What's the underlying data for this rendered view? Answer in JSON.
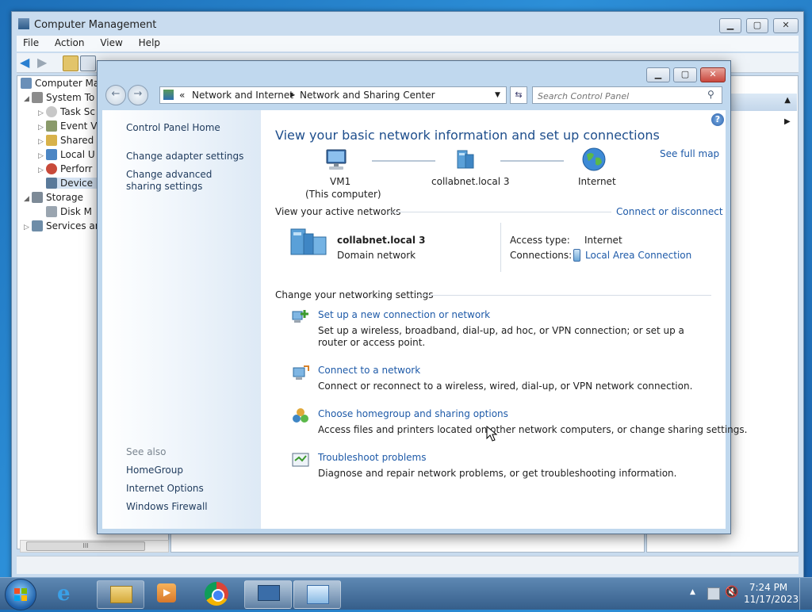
{
  "computer_management": {
    "title": "Computer Management",
    "menu": [
      "File",
      "Action",
      "View",
      "Help"
    ],
    "tree": [
      {
        "label": "Computer Ma",
        "icon": "computer-icon"
      },
      {
        "label": "System To",
        "icon": "tools-icon"
      },
      {
        "label": "Task Sc",
        "icon": "clock-icon"
      },
      {
        "label": "Event V",
        "icon": "event-viewer-icon"
      },
      {
        "label": "Shared",
        "icon": "shared-folder-icon"
      },
      {
        "label": "Local U",
        "icon": "users-icon"
      },
      {
        "label": "Perforr",
        "icon": "performance-icon"
      },
      {
        "label": "Device",
        "icon": "device-manager-icon"
      },
      {
        "label": "Storage",
        "icon": "storage-icon"
      },
      {
        "label": "Disk M",
        "icon": "disk-icon"
      },
      {
        "label": "Services ar",
        "icon": "services-icon"
      }
    ],
    "hscroll_glyph": "III"
  },
  "nsc": {
    "address": {
      "prefix": "«",
      "crumb1": "Network and Internet",
      "crumb2": "Network and Sharing Center"
    },
    "search_placeholder": "Search Control Panel",
    "left": {
      "home": "Control Panel Home",
      "adapter": "Change adapter settings",
      "advanced": "Change advanced sharing settings",
      "see_also": "See also",
      "homegroup": "HomeGroup",
      "internet_options": "Internet Options",
      "firewall": "Windows Firewall"
    },
    "heading": "View your basic network information and set up connections",
    "see_full_map": "See full map",
    "map": {
      "vm_name": "VM1",
      "vm_sub": "(This computer)",
      "domain": "collabnet.local  3",
      "internet": "Internet"
    },
    "active": {
      "label": "View your active networks",
      "connect_link": "Connect or disconnect",
      "network_name": "collabnet.local  3",
      "network_type": "Domain network",
      "access_label": "Access type:",
      "access_value": "Internet",
      "connections_label": "Connections:",
      "connections_value": "Local Area Connection"
    },
    "change": {
      "label": "Change your networking settings",
      "tasks": [
        {
          "title": "Set up a new connection or network",
          "desc": "Set up a wireless, broadband, dial-up, ad hoc, or VPN connection; or set up a router or access point."
        },
        {
          "title": "Connect to a network",
          "desc": "Connect or reconnect to a wireless, wired, dial-up, or VPN network connection."
        },
        {
          "title": "Choose homegroup and sharing options",
          "desc": "Access files and printers located on other network computers, or change sharing settings."
        },
        {
          "title": "Troubleshoot problems",
          "desc": "Diagnose and repair network problems, or get troubleshooting information."
        }
      ]
    }
  },
  "taskbar": {
    "time": "7:24 PM",
    "date": "11/17/2023"
  },
  "colors": {
    "link": "#1e5aa8",
    "heading": "#1e4e8c",
    "close_red": "#c9483e"
  }
}
